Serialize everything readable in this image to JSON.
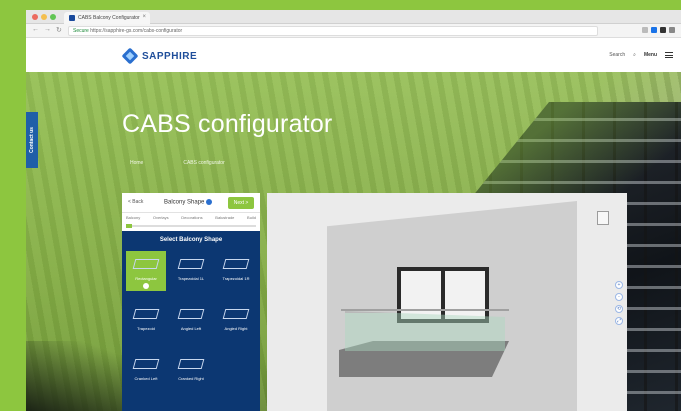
{
  "browser": {
    "tab_title": "CABS Balcony Configurator",
    "url_secure_label": "Secure",
    "url": "https://sapphire-gs.com/cabs-configurator"
  },
  "header": {
    "logo_text": "SAPPHIRE",
    "search_label": "Search",
    "menu_label": "Menu"
  },
  "hero": {
    "title": "CABS configurator",
    "breadcrumb": [
      "Home",
      "CABS configurator"
    ]
  },
  "contact_tab": "Contact us",
  "configurator": {
    "back_label": "< Back",
    "step_title": "Balcony Shape",
    "next_label": "Next >",
    "steps": [
      "Balcony",
      "Overlays",
      "Decorations",
      "Balustrade",
      "Build"
    ],
    "panel_title": "Select Balcony Shape",
    "shapes": [
      {
        "label": "Rectangular",
        "selected": true
      },
      {
        "label": "Trapezoidal 1L",
        "selected": false
      },
      {
        "label": "Trapezoidal 1R",
        "selected": false
      },
      {
        "label": "Trapezoid",
        "selected": false
      },
      {
        "label": "Angled Left",
        "selected": false
      },
      {
        "label": "Angled Right",
        "selected": false
      },
      {
        "label": "Cranked Left",
        "selected": false
      },
      {
        "label": "Cranked Right",
        "selected": false
      }
    ]
  },
  "viewer": {
    "controls": [
      "+",
      "-",
      "⟲",
      "⤢"
    ]
  },
  "colors": {
    "brand_green": "#8dc63f",
    "brand_blue": "#0c3772",
    "logo_blue": "#1f4e9a"
  }
}
